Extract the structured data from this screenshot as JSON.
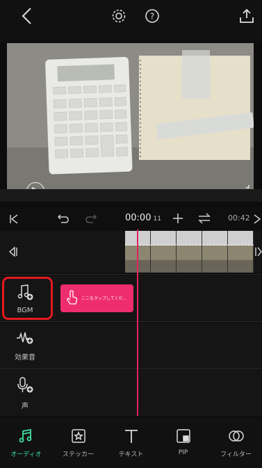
{
  "colors": {
    "accent": "#3fe0a2",
    "highlight_box": "#e6191f",
    "clip": "#ee2d6f",
    "playhead": "#e0245e"
  },
  "topbar": {
    "icons": [
      "back-icon",
      "settings-gear-icon",
      "help-icon",
      "export-share-icon"
    ]
  },
  "preview": {
    "icons": [
      "play-icon",
      "fullscreen-icon"
    ]
  },
  "timeline": {
    "timecode": "00:00",
    "timecode_frames": "11",
    "duration": "00:42",
    "icons": [
      "jump-start-icon",
      "undo-icon",
      "redo-icon",
      "add-icon",
      "swap-icon",
      "jump-end-icon"
    ]
  },
  "tracks": [
    {
      "id": "bgm",
      "label": "BGM",
      "icon": "music-note-add-icon"
    },
    {
      "id": "sfx",
      "label": "効果音",
      "icon": "waveform-add-icon"
    },
    {
      "id": "voice",
      "label": "声",
      "icon": "microphone-add-icon"
    }
  ],
  "bgm_clip": {
    "hint_text": "ここをタップしてくだ…"
  },
  "bottom_nav": [
    {
      "label": "オーディオ",
      "icon": "music-note-icon",
      "active": true
    },
    {
      "label": "ステッカー",
      "icon": "sticker-icon",
      "active": false
    },
    {
      "label": "テキスト",
      "icon": "text-icon",
      "active": false
    },
    {
      "label": "PIP",
      "icon": "pip-icon",
      "active": false
    },
    {
      "label": "フィルター",
      "icon": "filter-icon",
      "active": false
    }
  ]
}
